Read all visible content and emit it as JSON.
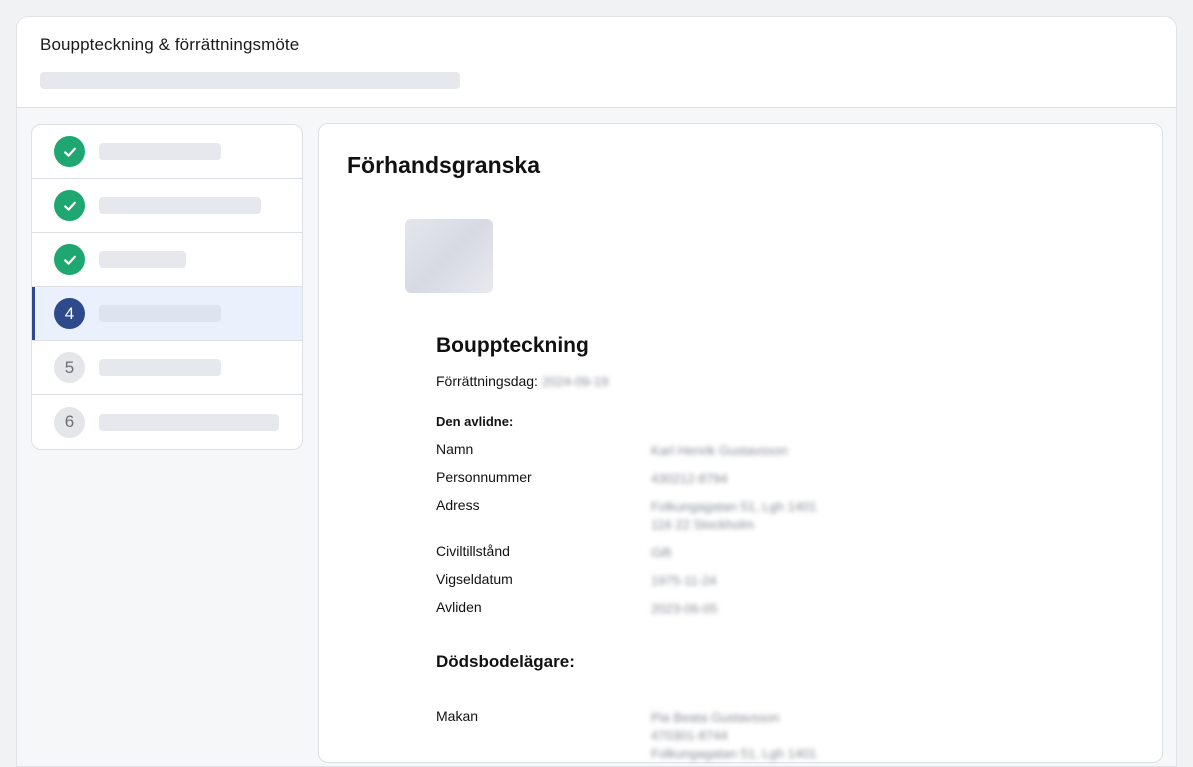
{
  "header": {
    "title": "Bouppteckning & förrättningsmöte"
  },
  "steps": [
    {
      "state": "done",
      "number": "1"
    },
    {
      "state": "done",
      "number": "2"
    },
    {
      "state": "done",
      "number": "3"
    },
    {
      "state": "current",
      "number": "4"
    },
    {
      "state": "todo",
      "number": "5"
    },
    {
      "state": "todo",
      "number": "6"
    }
  ],
  "colors": {
    "done": "#1fa772",
    "current": "#2e4a8a",
    "todo": "#e4e6ea"
  },
  "preview": {
    "title": "Förhandsgranska",
    "document": {
      "title": "Bouppteckning",
      "date_label": "Förrättningsdag:",
      "date_value": "2024-09-19",
      "deceased_heading": "Den avlidne:",
      "fields": [
        {
          "label": "Namn",
          "value": [
            "Karl Henrik Gustavsson"
          ]
        },
        {
          "label": "Personnummer",
          "value": [
            "430212-8794"
          ]
        },
        {
          "label": "Adress",
          "value": [
            "Folkungagatan 51, Lgh 1401",
            "116 22 Stockholm"
          ]
        },
        {
          "label": "Civiltillstånd",
          "value": [
            "Gift"
          ]
        },
        {
          "label": "Vigseldatum",
          "value": [
            "1975-11-24"
          ]
        },
        {
          "label": "Avliden",
          "value": [
            "2023-06-05"
          ]
        }
      ],
      "owners_heading": "Dödsbodelägare:",
      "owners": [
        {
          "label": "Makan",
          "value": [
            "Pia Beata Gustavsson",
            "470301-8744",
            "Folkungagatan 51, Lgh 1401"
          ]
        }
      ]
    }
  }
}
